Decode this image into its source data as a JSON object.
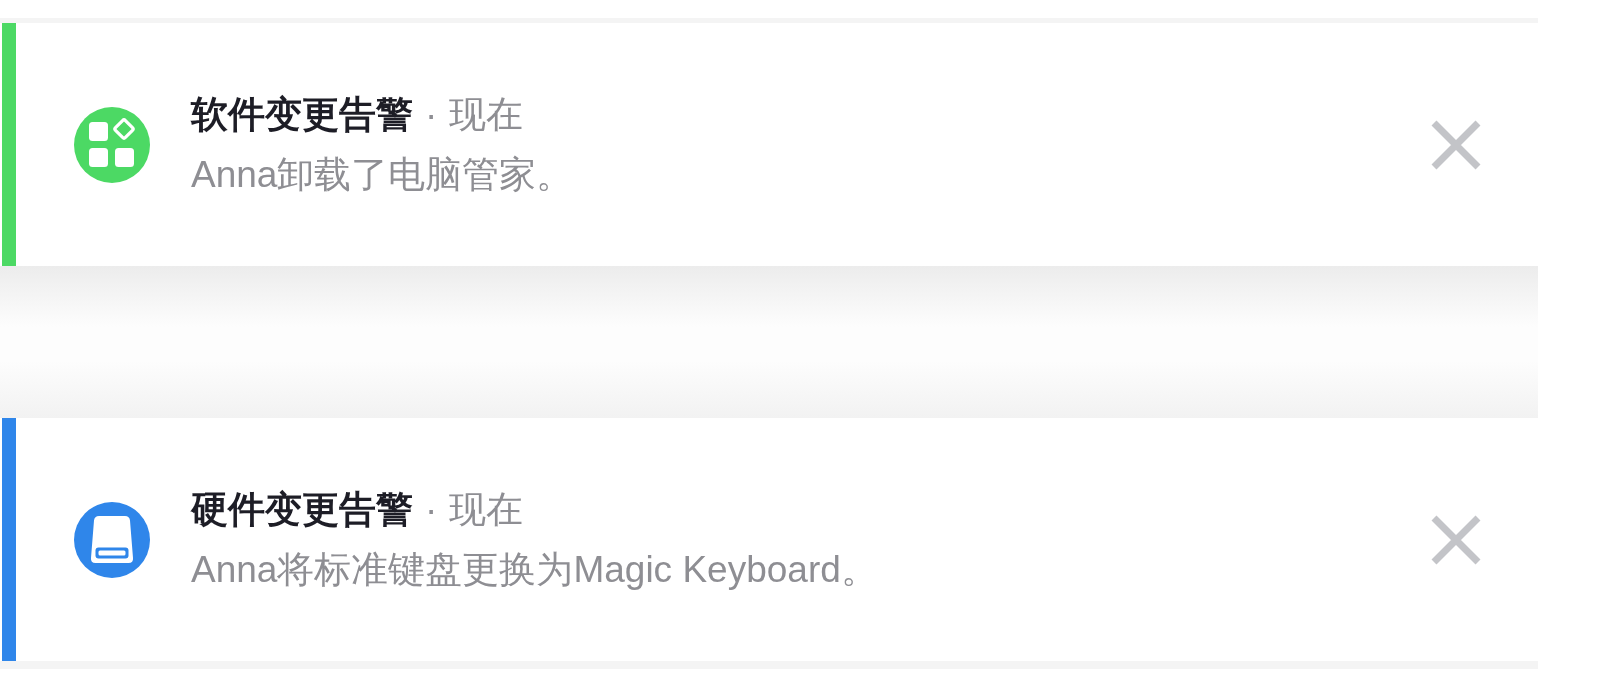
{
  "notifications": [
    {
      "kind": "software",
      "color": "#4cd964",
      "title": "软件变更告警",
      "separator": "·",
      "time": "现在",
      "message": "Anna卸载了电脑管家。"
    },
    {
      "kind": "hardware",
      "color": "#2f86ea",
      "title": "硬件变更告警",
      "separator": "·",
      "time": "现在",
      "message": "Anna将标准键盘更换为Magic Keyboard。"
    }
  ]
}
